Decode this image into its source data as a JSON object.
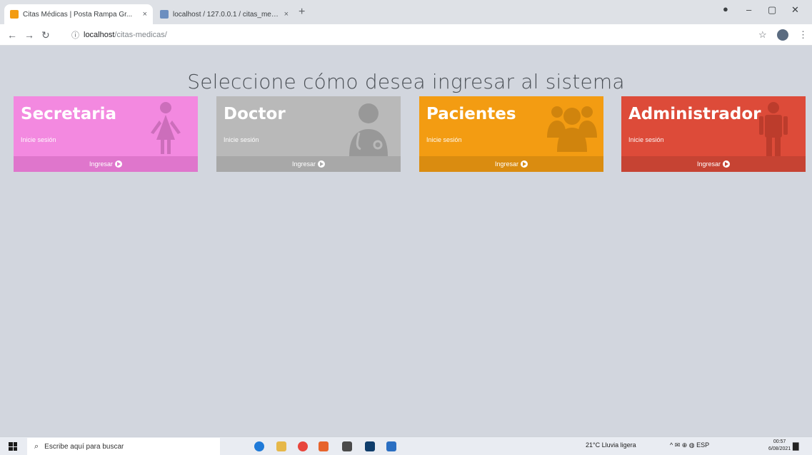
{
  "browser": {
    "tabs": [
      {
        "title": "Citas Médicas | Posta Rampa Gr...",
        "active": true
      },
      {
        "title": "localhost / 127.0.0.1 / citas_medi...",
        "active": false
      }
    ],
    "new_tab": "+",
    "close_glyph": "×",
    "window_controls": {
      "minimize": "–",
      "maximize": "▢",
      "close": "✕"
    },
    "address": {
      "host": "localhost",
      "path": "/citas-medicas/"
    }
  },
  "page": {
    "title": "Seleccione cómo desea ingresar al sistema",
    "cards": [
      {
        "title": "Secretaria",
        "subtitle": "Inicie sesión",
        "footer": "Ingresar",
        "icon": "female-icon",
        "color": "#f389e0"
      },
      {
        "title": "Doctor",
        "subtitle": "Inicie sesión",
        "footer": "Ingresar",
        "icon": "doctor-icon",
        "color": "#b9b9b9"
      },
      {
        "title": "Pacientes",
        "subtitle": "Inicie sesión",
        "footer": "Ingresar",
        "icon": "users-icon",
        "color": "#f39c12"
      },
      {
        "title": "Administrador",
        "subtitle": "Inicie sesión",
        "footer": "Ingresar",
        "icon": "male-icon",
        "color": "#dd4b39"
      }
    ]
  },
  "taskbar": {
    "search_placeholder": "Escribe aquí para buscar",
    "weather": "21°C  Lluvia ligera",
    "tray_text": "^  ✉  ⊕  ◍  ESP",
    "time": "00:57",
    "date": "6/08/2021"
  }
}
